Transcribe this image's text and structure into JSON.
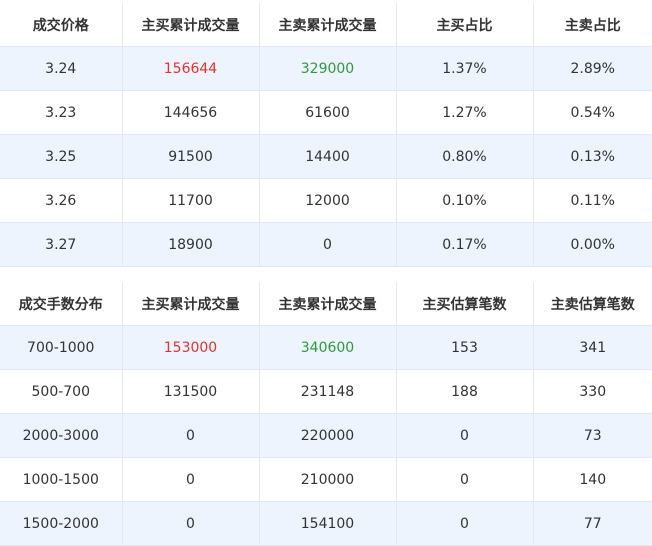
{
  "price_table": {
    "headers": [
      "成交价格",
      "主买累计成交量",
      "主卖累计成交量",
      "主买占比",
      "主卖占比"
    ],
    "rows": [
      [
        "3.24",
        "156644",
        "329000",
        "1.37%",
        "2.89%"
      ],
      [
        "3.23",
        "144656",
        "61600",
        "1.27%",
        "0.54%"
      ],
      [
        "3.25",
        "91500",
        "14400",
        "0.80%",
        "0.13%"
      ],
      [
        "3.26",
        "11700",
        "12000",
        "0.10%",
        "0.11%"
      ],
      [
        "3.27",
        "18900",
        "0",
        "0.17%",
        "0.00%"
      ]
    ]
  },
  "distribution_table": {
    "headers": [
      "成交手数分布",
      "主买累计成交量",
      "主卖累计成交量",
      "主买估算笔数",
      "主卖估算笔数"
    ],
    "rows": [
      [
        "700-1000",
        "153000",
        "340600",
        "153",
        "341"
      ],
      [
        "500-700",
        "131500",
        "231148",
        "188",
        "330"
      ],
      [
        "2000-3000",
        "0",
        "220000",
        "0",
        "73"
      ],
      [
        "1000-1500",
        "0",
        "210000",
        "0",
        "140"
      ],
      [
        "1500-2000",
        "0",
        "154100",
        "0",
        "77"
      ]
    ]
  },
  "colors": {
    "buy_highlight": "#e9302d",
    "sell_highlight": "#2e9a3b",
    "row_stripe": "#edf4fd",
    "grid_line": "#e3e9f1"
  }
}
